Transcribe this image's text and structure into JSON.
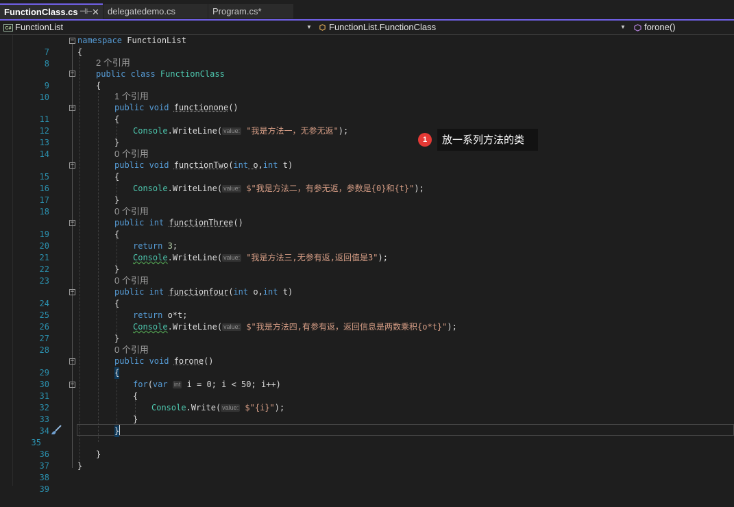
{
  "tabs": [
    {
      "label": "FunctionClass.cs",
      "active": true,
      "pin": "⊣⊢",
      "close": "✕"
    },
    {
      "label": "delegatedemo.cs",
      "active": false
    },
    {
      "label": "Program.cs*",
      "active": false
    }
  ],
  "navbar": {
    "project": "FunctionList",
    "cs_badge": "C#",
    "type": "FunctionList.FunctionClass",
    "member": "forone()"
  },
  "refs": {
    "two": "2 个引用",
    "one": "1 个引用",
    "zero": "0 个引用"
  },
  "hints": {
    "value": "value:",
    "int": "int"
  },
  "code": {
    "ns_kw": "namespace",
    "ns_name": " FunctionList",
    "open": "{",
    "close": "}",
    "class_mods": "public class ",
    "class_name": "FunctionClass",
    "pub_void": "public void ",
    "pub_int": "public int ",
    "fn1": "functionone",
    "fn2": "functionTwo",
    "fn3": "functionThree",
    "fn4": "functionfour",
    "fn5": "forone",
    "empty_params": "()",
    "params_o_t_1": "(",
    "int_kw": "int",
    "o_param": " o",
    "comma": ",",
    "t_param": " t",
    "rparen": ")",
    "console": "Console",
    "dot": ".",
    "writeline": "WriteLine",
    "write": "Write",
    "lparen": "(",
    "str1": " \"我是方法一，无参无返\"",
    "str2": " $\"我是方法二，有参无返，参数是{0}和{t}\"",
    "str3": " \"我是方法三,无参有返,返回值是3\"",
    "str4": " $\"我是方法四,有参有返，返回信息是两数乘积{o*t}\"",
    "str5": " $\"{i}\"",
    "end_call": ");",
    "return_kw": "return",
    "ret3": " 3",
    "ret_ot": " o*t",
    "semi": ";",
    "for_kw": "for",
    "var_kw": "var",
    "for_rest": " i = 0; i < 50; i++)"
  },
  "line_numbers": [
    "7",
    "8",
    "9",
    "10",
    "11",
    "12",
    "13",
    "14",
    "15",
    "16",
    "17",
    "18",
    "19",
    "20",
    "21",
    "22",
    "23",
    "24",
    "25",
    "26",
    "27",
    "28",
    "29",
    "30",
    "31",
    "32",
    "33",
    "34",
    "35",
    "36",
    "37",
    "38",
    "39"
  ],
  "callout": {
    "badge": "1",
    "text": "放一系列方法的类"
  },
  "colors": {
    "accent": "#7160e8",
    "keyword": "#569cd6",
    "type": "#4ec9b0",
    "string": "#d69d85",
    "line_number": "#2b91af"
  }
}
